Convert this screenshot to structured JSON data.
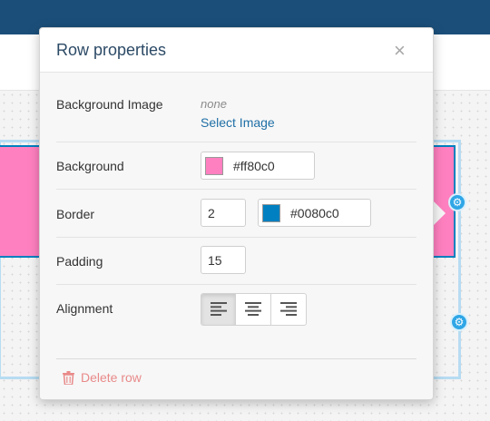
{
  "dialog": {
    "title": "Row properties",
    "close_symbol": "×"
  },
  "fields": {
    "background_image": {
      "label": "Background Image",
      "value": "none",
      "select_link": "Select Image"
    },
    "background": {
      "label": "Background",
      "color_hex": "#ff80c0"
    },
    "border": {
      "label": "Border",
      "width": "2",
      "color_hex": "#0080c0"
    },
    "padding": {
      "label": "Padding",
      "value": "15"
    },
    "alignment": {
      "label": "Alignment",
      "options": [
        "align-left",
        "align-center",
        "align-right"
      ],
      "selected": "align-left"
    }
  },
  "footer": {
    "delete_label": "Delete row"
  },
  "colors": {
    "accent": "#1f6fa6",
    "header_bar": "#1b4f7a",
    "row_background": "#ff80c0",
    "row_border": "#0080c0",
    "delete": "#e98a8a"
  },
  "icons": {
    "close": "close-icon",
    "row_settings": "gear-icon",
    "delete": "trash-icon"
  }
}
